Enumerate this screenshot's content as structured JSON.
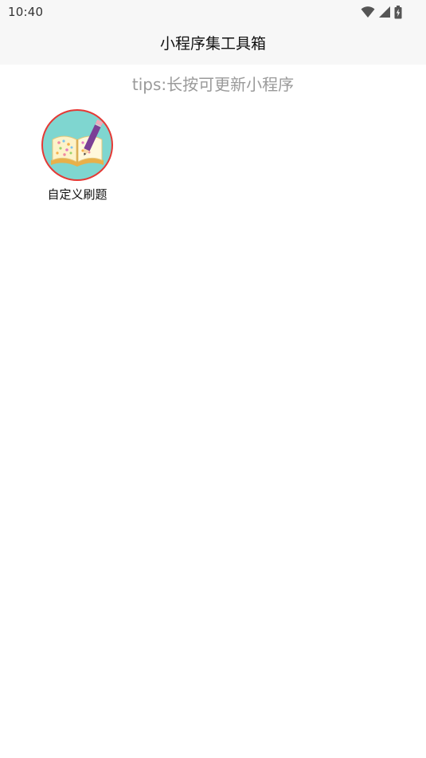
{
  "status_bar": {
    "time": "10:40",
    "icons": [
      "wifi-icon",
      "cellular-signal-icon",
      "battery-charging-icon"
    ]
  },
  "nav_bar": {
    "title": "小程序集工具箱"
  },
  "tips": {
    "text": "tips:长按可更新小程序"
  },
  "apps": [
    {
      "label": "自定义刷题",
      "icon": "open-book-pencil-icon"
    }
  ],
  "colors": {
    "bar_background": "#f7f7f7",
    "tips_text": "#9a9a9a",
    "icon_border": "#e53935",
    "icon_background": "#7fd6d0"
  }
}
